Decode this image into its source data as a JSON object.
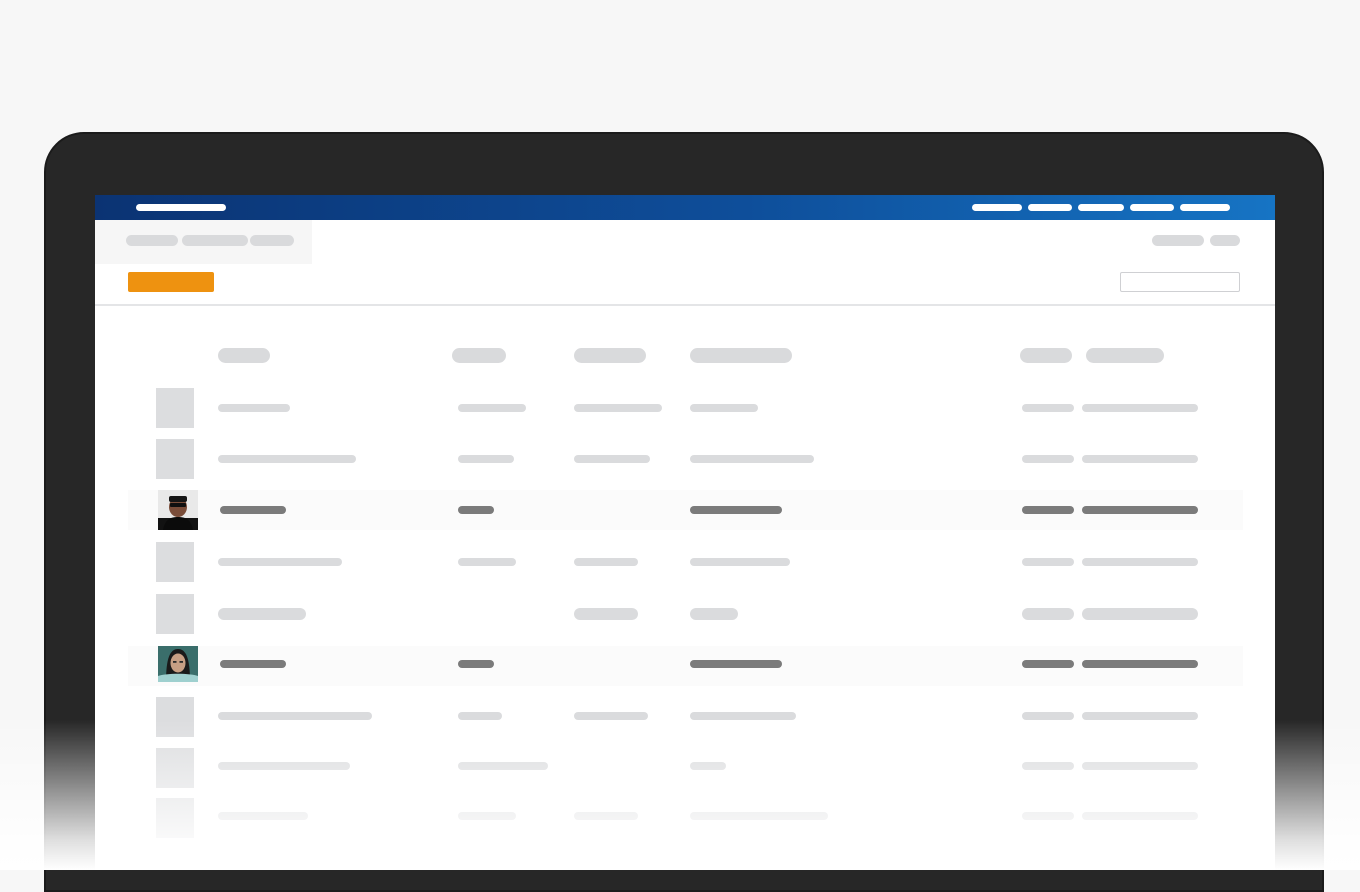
{
  "app": {
    "accent": "#ee9210",
    "topbar_gradient": [
      "#0b3373",
      "#1674c4"
    ]
  },
  "header": {
    "columns": [
      "",
      "",
      "",
      "",
      "",
      ""
    ]
  },
  "rows": [
    {
      "kind": "placeholder"
    },
    {
      "kind": "placeholder"
    },
    {
      "kind": "highlighted",
      "avatar": "man-with-sunglasses-photo"
    },
    {
      "kind": "placeholder"
    },
    {
      "kind": "placeholder"
    },
    {
      "kind": "highlighted",
      "avatar": "woman-portrait-photo"
    },
    {
      "kind": "placeholder"
    },
    {
      "kind": "placeholder"
    },
    {
      "kind": "placeholder"
    }
  ],
  "icons": {
    "primary_action": "add-button",
    "search": "search-input"
  }
}
